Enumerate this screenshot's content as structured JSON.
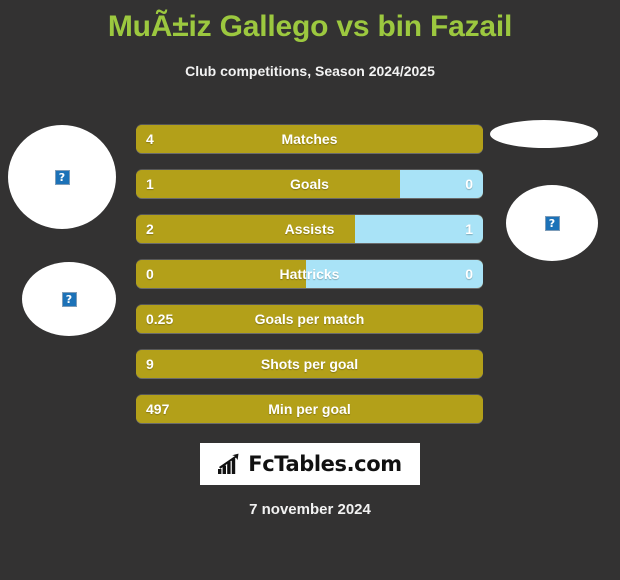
{
  "header": {
    "title": "MuÃ±iz Gallego vs bin Fazail",
    "subtitle": "Club competitions, Season 2024/2025"
  },
  "colors": {
    "background": "#333232",
    "title_green": "#9cc83f",
    "home_gold": "#b3a019",
    "away_blue": "#a9e3f7",
    "text_white": "#ffffff"
  },
  "avatars": {
    "left_player_placeholder": "broken-image-icon",
    "left_club_placeholder": "broken-image-icon",
    "right_player_placeholder": "broken-image-icon",
    "right_club_placeholder": "broken-image-icon",
    "placeholder_glyph": "?"
  },
  "chart_data": {
    "type": "bar",
    "title": "MuÃ±iz Gallego vs bin Fazail",
    "subtitle": "Club competitions, Season 2024/2025",
    "orientation": "horizontal-split",
    "categories": [
      "Matches",
      "Goals",
      "Assists",
      "Hattricks",
      "Goals per match",
      "Shots per goal",
      "Min per goal"
    ],
    "series": [
      {
        "name": "MuÃ±iz Gallego",
        "color": "#b3a019",
        "values": [
          "4",
          "1",
          "2",
          "0",
          "0.25",
          "9",
          "497"
        ]
      },
      {
        "name": "bin Fazail",
        "color": "#a9e3f7",
        "values": [
          null,
          "0",
          "1",
          "0",
          null,
          null,
          null
        ]
      }
    ],
    "rows": [
      {
        "label": "Matches",
        "home": "4",
        "away": null,
        "home_pct": 100,
        "has_away": false
      },
      {
        "label": "Goals",
        "home": "1",
        "away": "0",
        "home_pct": 76,
        "has_away": true
      },
      {
        "label": "Assists",
        "home": "2",
        "away": "1",
        "home_pct": 63,
        "has_away": true
      },
      {
        "label": "Hattricks",
        "home": "0",
        "away": "0",
        "home_pct": 49,
        "has_away": true
      },
      {
        "label": "Goals per match",
        "home": "0.25",
        "away": null,
        "home_pct": 100,
        "has_away": false
      },
      {
        "label": "Shots per goal",
        "home": "9",
        "away": null,
        "home_pct": 100,
        "has_away": false
      },
      {
        "label": "Min per goal",
        "home": "497",
        "away": null,
        "home_pct": 100,
        "has_away": false
      }
    ]
  },
  "footer": {
    "logo_text": "FcTables.com",
    "logo_icon": "bar-chart-arrow-icon",
    "date": "7 november 2024"
  }
}
